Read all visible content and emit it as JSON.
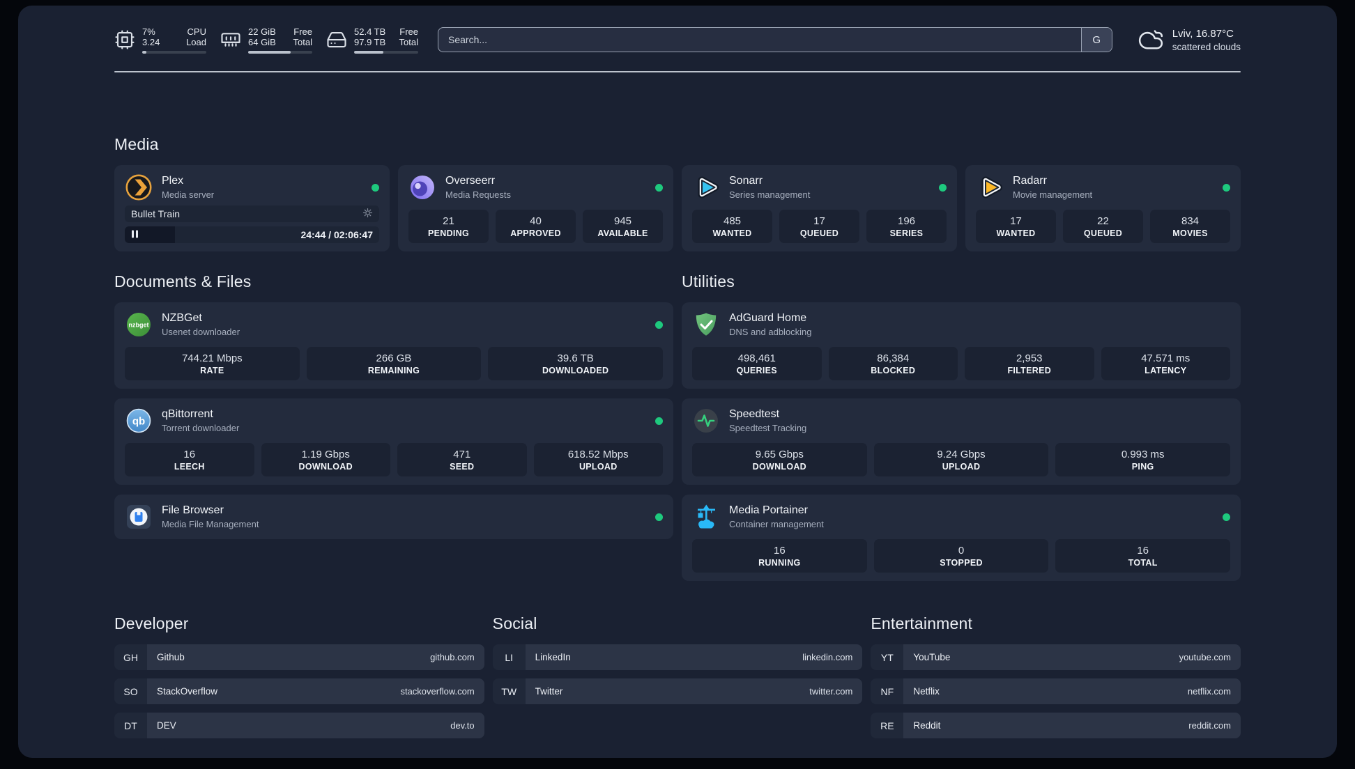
{
  "header": {
    "cpu": {
      "values": [
        "7%",
        "3.24"
      ],
      "labels": [
        "CPU",
        "Load"
      ],
      "progress": 7
    },
    "ram": {
      "values": [
        "22 GiB",
        "64 GiB"
      ],
      "labels": [
        "Free",
        "Total"
      ],
      "progress": 66
    },
    "disk": {
      "values": [
        "52.4 TB",
        "97.9 TB"
      ],
      "labels": [
        "Free",
        "Total"
      ],
      "progress": 46
    },
    "search": {
      "placeholder": "Search...",
      "button_label": "G"
    },
    "weather": {
      "location": "Lviv, 16.87°C",
      "condition": "scattered clouds"
    }
  },
  "media": {
    "title": "Media",
    "plex": {
      "name": "Plex",
      "description": "Media server",
      "status": "online",
      "now_playing": {
        "title": "Bullet Train",
        "time": "24:44 / 02:06:47",
        "progress_pct": 19.6
      }
    },
    "overseerr": {
      "name": "Overseerr",
      "description": "Media Requests",
      "status": "online",
      "stats": [
        {
          "value": "21",
          "label": "PENDING"
        },
        {
          "value": "40",
          "label": "APPROVED"
        },
        {
          "value": "945",
          "label": "AVAILABLE"
        }
      ]
    },
    "sonarr": {
      "name": "Sonarr",
      "description": "Series management",
      "status": "online",
      "stats": [
        {
          "value": "485",
          "label": "WANTED"
        },
        {
          "value": "17",
          "label": "QUEUED"
        },
        {
          "value": "196",
          "label": "SERIES"
        }
      ]
    },
    "radarr": {
      "name": "Radarr",
      "description": "Movie management",
      "status": "online",
      "stats": [
        {
          "value": "17",
          "label": "WANTED"
        },
        {
          "value": "22",
          "label": "QUEUED"
        },
        {
          "value": "834",
          "label": "MOVIES"
        }
      ]
    }
  },
  "documents": {
    "title": "Documents & Files",
    "nzbget": {
      "name": "NZBGet",
      "description": "Usenet downloader",
      "status": "online",
      "stats": [
        {
          "value": "744.21 Mbps",
          "label": "RATE"
        },
        {
          "value": "266 GB",
          "label": "REMAINING"
        },
        {
          "value": "39.6 TB",
          "label": "DOWNLOADED"
        }
      ]
    },
    "qbittorrent": {
      "name": "qBittorrent",
      "description": "Torrent downloader",
      "status": "online",
      "stats": [
        {
          "value": "16",
          "label": "LEECH"
        },
        {
          "value": "1.19 Gbps",
          "label": "DOWNLOAD"
        },
        {
          "value": "471",
          "label": "SEED"
        },
        {
          "value": "618.52 Mbps",
          "label": "UPLOAD"
        }
      ]
    },
    "filebrowser": {
      "name": "File Browser",
      "description": "Media File Management",
      "status": "online"
    }
  },
  "utilities": {
    "title": "Utilities",
    "adguard": {
      "name": "AdGuard Home",
      "description": "DNS and adblocking",
      "stats": [
        {
          "value": "498,461",
          "label": "QUERIES"
        },
        {
          "value": "86,384",
          "label": "BLOCKED"
        },
        {
          "value": "2,953",
          "label": "FILTERED"
        },
        {
          "value": "47.571 ms",
          "label": "LATENCY"
        }
      ]
    },
    "speedtest": {
      "name": "Speedtest",
      "description": "Speedtest Tracking",
      "stats": [
        {
          "value": "9.65 Gbps",
          "label": "DOWNLOAD"
        },
        {
          "value": "9.24 Gbps",
          "label": "UPLOAD"
        },
        {
          "value": "0.993 ms",
          "label": "PING"
        }
      ]
    },
    "portainer": {
      "name": "Media Portainer",
      "description": "Container management",
      "status": "online",
      "stats": [
        {
          "value": "16",
          "label": "RUNNING"
        },
        {
          "value": "0",
          "label": "STOPPED"
        },
        {
          "value": "16",
          "label": "TOTAL"
        }
      ]
    }
  },
  "bookmarks": {
    "developer": {
      "title": "Developer",
      "items": [
        {
          "abbr": "GH",
          "name": "Github",
          "url": "github.com"
        },
        {
          "abbr": "SO",
          "name": "StackOverflow",
          "url": "stackoverflow.com"
        },
        {
          "abbr": "DT",
          "name": "DEV",
          "url": "dev.to"
        }
      ]
    },
    "social": {
      "title": "Social",
      "items": [
        {
          "abbr": "LI",
          "name": "LinkedIn",
          "url": "linkedin.com"
        },
        {
          "abbr": "TW",
          "name": "Twitter",
          "url": "twitter.com"
        }
      ]
    },
    "entertainment": {
      "title": "Entertainment",
      "items": [
        {
          "abbr": "YT",
          "name": "YouTube",
          "url": "youtube.com"
        },
        {
          "abbr": "NF",
          "name": "Netflix",
          "url": "netflix.com"
        },
        {
          "abbr": "RE",
          "name": "Reddit",
          "url": "reddit.com"
        }
      ]
    }
  },
  "colors": {
    "status_online": "#1ec97e",
    "progress_fill": "#bac1cc",
    "plex_gold": "#e8a33d",
    "sonarr_cyan": "#36c3f1",
    "radarr_amber": "#fcb827",
    "overseerr_purple": "#8273ee",
    "nzbget_green": "#4ca644",
    "qbittorrent_blue": "#5a9bd8",
    "filebrowser_blue": "#2f80ed",
    "adguard_green": "#68bd71",
    "speedtest_green": "#35d07e",
    "portainer_blue": "#29b9f7"
  }
}
